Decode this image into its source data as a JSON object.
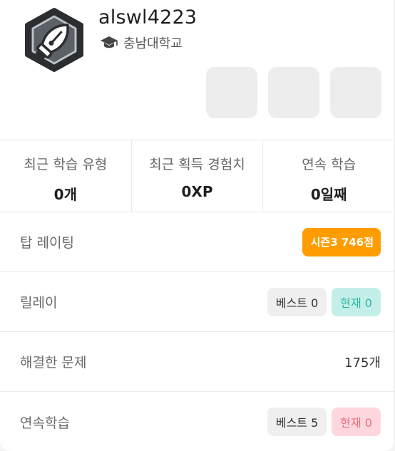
{
  "profile": {
    "username": "alswl4223",
    "school": "충남대학교",
    "badge_icon": "fountain-pen-nib-hexagon",
    "school_icon": "graduation-cap-icon"
  },
  "stats": [
    {
      "label": "최근 학습 유형",
      "value": "0개"
    },
    {
      "label": "최근 획득 경험치",
      "value": "0XP"
    },
    {
      "label": "연속 학습",
      "value": "0일째"
    }
  ],
  "rating": {
    "label": "탑 레이팅",
    "badge": "시즌3 746점",
    "badge_color": "#ff9d00"
  },
  "relay": {
    "label": "릴레이",
    "best": "베스트 0",
    "current": "현재 0",
    "current_color": "#2fb7a4"
  },
  "solved": {
    "label": "해결한 문제",
    "value": "175개"
  },
  "streak": {
    "label": "연속학습",
    "best": "베스트 5",
    "current": "현재 0",
    "current_color": "#ee6b80"
  }
}
